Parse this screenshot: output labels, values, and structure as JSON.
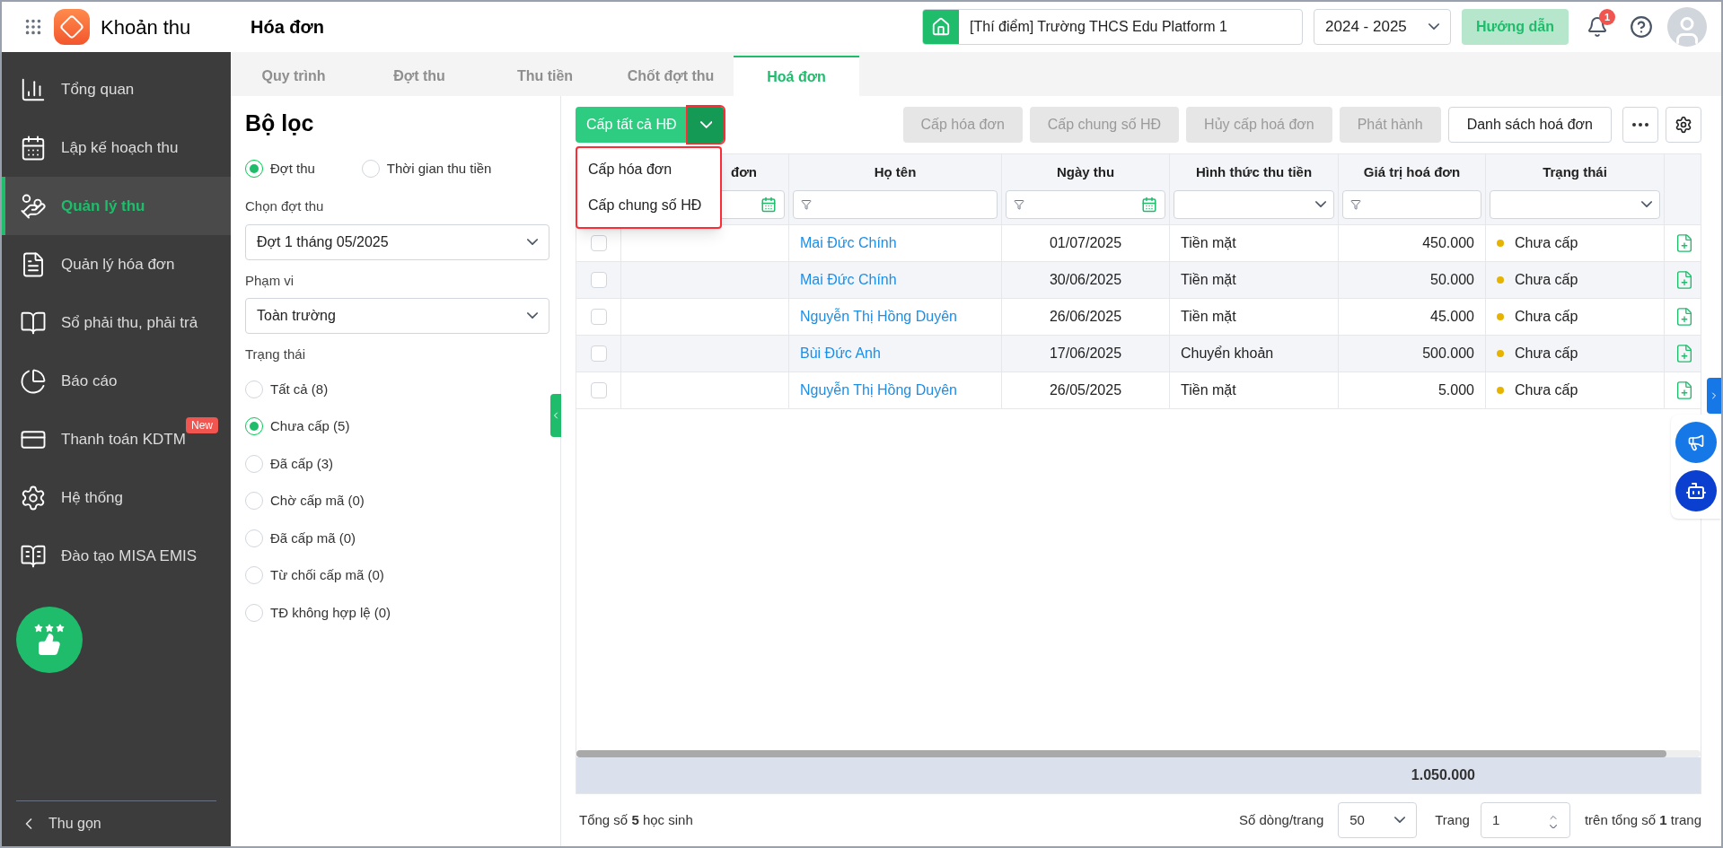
{
  "app": {
    "title": "Khoản thu"
  },
  "page_title": "Hóa đơn",
  "header": {
    "school": "[Thí điểm] Trường THCS Edu Platform 1",
    "year": "2024 - 2025",
    "guide_button": "Hướng dẫn",
    "notification_count": "1"
  },
  "sidebar": {
    "items": [
      {
        "label": "Tổng quan",
        "selected": false
      },
      {
        "label": "Lập kế hoạch thu",
        "selected": false
      },
      {
        "label": "Quản lý thu",
        "selected": true
      },
      {
        "label": "Quản lý hóa đơn",
        "selected": false
      },
      {
        "label": "Sổ phải thu, phải trả",
        "selected": false
      },
      {
        "label": "Báo cáo",
        "selected": false
      },
      {
        "label": "Thanh toán KDTM",
        "selected": false,
        "badge": "New"
      },
      {
        "label": "Hệ thống",
        "selected": false
      },
      {
        "label": "Đào tạo MISA EMIS",
        "selected": false
      }
    ],
    "collapse": "Thu gọn"
  },
  "tabs": [
    {
      "label": "Quy trình",
      "selected": false
    },
    {
      "label": "Đợt thu",
      "selected": false
    },
    {
      "label": "Thu tiền",
      "selected": false
    },
    {
      "label": "Chốt đợt thu",
      "selected": false
    },
    {
      "label": "Hoá đơn",
      "selected": true
    }
  ],
  "filter": {
    "title": "Bộ lọc",
    "mode_options": [
      {
        "label": "Đợt thu",
        "selected": true
      },
      {
        "label": "Thời gian thu tiền",
        "selected": false
      }
    ],
    "batch_label": "Chọn đợt thu",
    "batch_value": "Đợt 1 tháng 05/2025",
    "scope_label": "Phạm vi",
    "scope_value": "Toàn trường",
    "status_label": "Trạng thái",
    "status_options": [
      {
        "label": "Tất cả (8)",
        "selected": false
      },
      {
        "label": "Chưa cấp (5)",
        "selected": true
      },
      {
        "label": "Đã cấp (3)",
        "selected": false
      },
      {
        "label": "Chờ cấp mã (0)",
        "selected": false
      },
      {
        "label": "Đã cấp mã (0)",
        "selected": false
      },
      {
        "label": "Từ chối cấp mã (0)",
        "selected": false
      },
      {
        "label": "TĐ không hợp lệ (0)",
        "selected": false
      }
    ]
  },
  "toolbar": {
    "primary": "Cấp tất cả HĐ",
    "menu_open": true,
    "menu": [
      "Cấp hóa đơn",
      "Cấp chung số HĐ"
    ],
    "actions": [
      {
        "label": "Cấp hóa đơn",
        "disabled": true
      },
      {
        "label": "Cấp chung số HĐ",
        "disabled": true
      },
      {
        "label": "Hủy cấp hoá đơn",
        "disabled": true
      },
      {
        "label": "Phát hành",
        "disabled": true
      },
      {
        "label": "Danh sách hoá đơn",
        "disabled": false
      }
    ]
  },
  "table": {
    "columns": [
      {
        "label": "đơn"
      },
      {
        "label": "Họ tên"
      },
      {
        "label": "Ngày thu"
      },
      {
        "label": "Hình thức thu tiền"
      },
      {
        "label": "Giá trị hoá đơn"
      },
      {
        "label": "Trạng thái"
      }
    ],
    "rows": [
      {
        "checked": false,
        "name": "Mai Đức Chính",
        "date": "01/07/2025",
        "method": "Tiền mặt",
        "amount": "450.000",
        "status": "Chưa cấp",
        "color": "#e6b400"
      },
      {
        "checked": false,
        "name": "Mai Đức Chính",
        "date": "30/06/2025",
        "method": "Tiền mặt",
        "amount": "50.000",
        "status": "Chưa cấp",
        "color": "#e6b400"
      },
      {
        "checked": false,
        "name": "Nguyễn Thị Hồng Duyên",
        "date": "26/06/2025",
        "method": "Tiền mặt",
        "amount": "45.000",
        "status": "Chưa cấp",
        "color": "#e6b400"
      },
      {
        "checked": false,
        "name": "Bùi Đức Anh",
        "date": "17/06/2025",
        "method": "Chuyển khoản",
        "amount": "500.000",
        "status": "Chưa cấp",
        "color": "#e6b400"
      },
      {
        "checked": false,
        "name": "Nguyễn Thị Hồng Duyên",
        "date": "26/05/2025",
        "method": "Tiền mặt",
        "amount": "5.000",
        "status": "Chưa cấp",
        "color": "#e6b400"
      }
    ],
    "total": "1.050.000"
  },
  "pagination": {
    "summary": "Tổng số **5** học sinh",
    "rows_label": "Số dòng/trang",
    "page_size": "50",
    "page_label": "Trang",
    "page": "1",
    "page_total": "trên tổng số **1** trang"
  }
}
